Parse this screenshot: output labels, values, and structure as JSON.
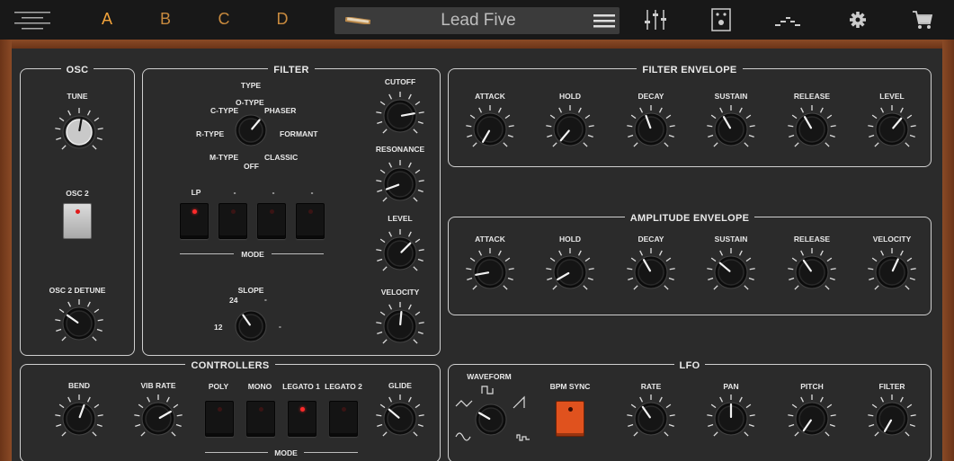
{
  "topbar": {
    "presets": [
      "A",
      "B",
      "C",
      "D"
    ],
    "active_preset": "A",
    "preset_name": "Lead Five",
    "accent_color": "#f2a33a",
    "icons": [
      "menu-icon",
      "keyboard-icon",
      "list-icon",
      "mixer-sliders-icon",
      "effects-pedal-icon",
      "sequencer-icon",
      "gear-icon",
      "cart-icon"
    ]
  },
  "osc": {
    "title": "OSC",
    "tune_label": "TUNE",
    "osc2_label": "OSC 2",
    "detune_label": "OSC 2 DETUNE"
  },
  "filter": {
    "title": "FILTER",
    "type_label": "TYPE",
    "type_options": [
      "O-TYPE",
      "PHASER",
      "FORMANT",
      "CLASSIC",
      "OFF",
      "M-TYPE",
      "R-TYPE",
      "C-TYPE"
    ],
    "mode_buttons": [
      "LP",
      "-",
      "-",
      "-"
    ],
    "mode_label": "MODE",
    "slope_label": "SLOPE",
    "slope_options": [
      "12",
      "24",
      "-",
      "-"
    ],
    "cutoff_label": "CUTOFF",
    "resonance_label": "RESONANCE",
    "level_label": "LEVEL",
    "velocity_label": "VELOCITY"
  },
  "filter_envelope": {
    "title": "FILTER ENVELOPE",
    "knobs": [
      "ATTACK",
      "HOLD",
      "DECAY",
      "SUSTAIN",
      "RELEASE",
      "LEVEL"
    ]
  },
  "amp_envelope": {
    "title": "AMPLITUDE ENVELOPE",
    "knobs": [
      "ATTACK",
      "HOLD",
      "DECAY",
      "SUSTAIN",
      "RELEASE",
      "VELOCITY"
    ]
  },
  "controllers": {
    "title": "CONTROLLERS",
    "bend_label": "BEND",
    "vib_label": "VIB RATE",
    "mode_buttons": [
      "POLY",
      "MONO",
      "LEGATO 1",
      "LEGATO 2"
    ],
    "mode_label": "MODE",
    "glide_label": "GLIDE"
  },
  "lfo": {
    "title": "LFO",
    "waveform_label": "WAVEFORM",
    "bpm_sync_label": "BPM SYNC",
    "knobs": [
      "RATE",
      "PAN",
      "PITCH",
      "FILTER"
    ],
    "bpm_color": "#e0521e"
  }
}
